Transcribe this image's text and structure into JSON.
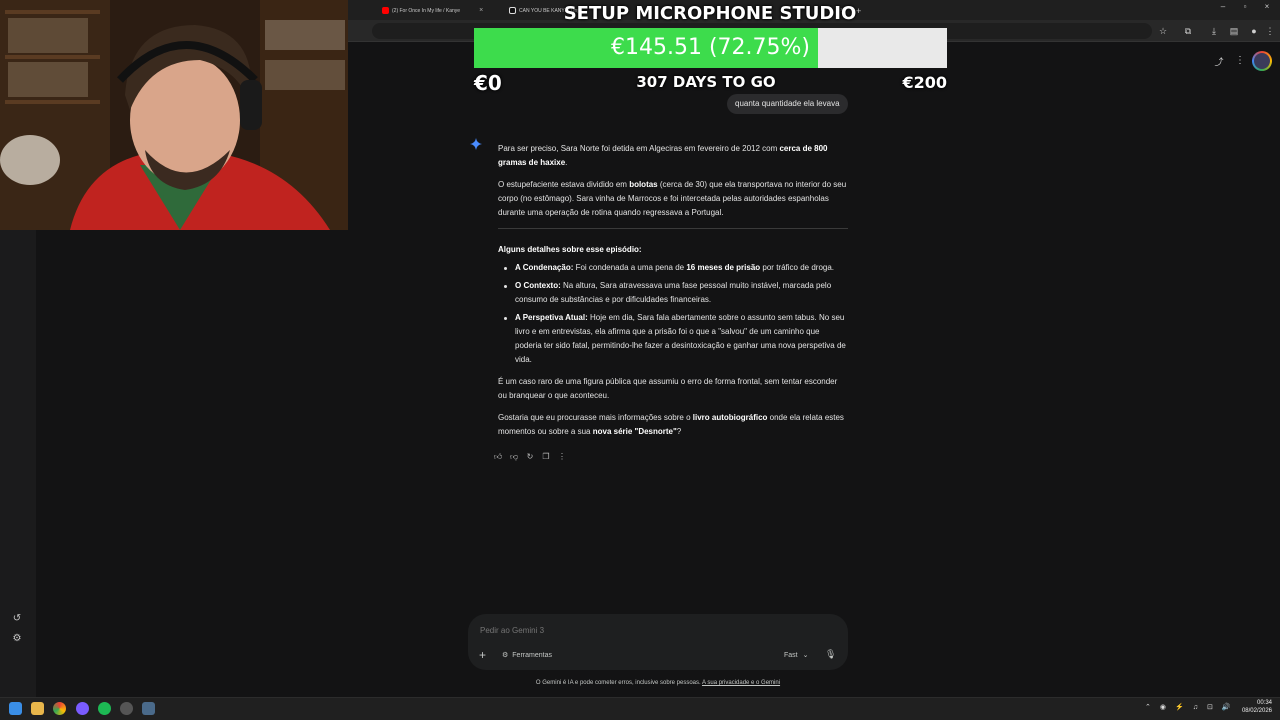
{
  "browser": {
    "tabs": [
      {
        "label": "(2) For Once In My life / Kanye",
        "icon": "youtube-icon",
        "color": "#ff0000"
      },
      {
        "label": "CAN YOU BE KANYE: Unpa",
        "icon": "tiktok-icon",
        "color": "#ffffff"
      }
    ],
    "new_tab": "+"
  },
  "overlay": {
    "title": "SETUP MICROPHONE STUDIO",
    "goal_text": "€145.51 (72.75%)",
    "goal_fraction": 0.7275,
    "goal_min": "€0",
    "goal_max": "€200",
    "days_left": "307 DAYS TO GO"
  },
  "chat": {
    "user_message": "quanta quantidade ela levava",
    "answer": {
      "p1_a": "Para ser preciso, Sara Norte foi detida em Algeciras em fevereiro de 2012 com ",
      "p1_b": "cerca de 800 gramas de haxixe",
      "p1_c": ".",
      "p2_a": "O estupefaciente estava dividido em ",
      "p2_b": "bolotas",
      "p2_c": " (cerca de 30) que ela transportava no interior do seu corpo (no estômago). Sara vinha de Marrocos e foi intercetada pelas autoridades espanholas durante uma operação de rotina quando regressava a Portugal.",
      "details_heading": "Alguns detalhes sobre esse episódio:",
      "b1_label": "A Condenação:",
      "b1_a": " Foi condenada a uma pena de ",
      "b1_b": "16 meses de prisão",
      "b1_c": " por tráfico de droga.",
      "b2_label": "O Contexto:",
      "b2_text": " Na altura, Sara atravessava uma fase pessoal muito instável, marcada pelo consumo de substâncias e por dificuldades financeiras.",
      "b3_label": "A Perspetiva Atual:",
      "b3_text": " Hoje em dia, Sara fala abertamente sobre o assunto sem tabus. No seu livro e em entrevistas, ela afirma que a prisão foi o que a \"salvou\" de um caminho que poderia ter sido fatal, permitindo-lhe fazer a desintoxicação e ganhar uma nova perspetiva de vida.",
      "p3": "É um caso raro de uma figura pública que assumiu o erro de forma frontal, sem tentar esconder ou branquear o que aconteceu.",
      "p4_a": "Gostaria que eu procurasse mais informações sobre o ",
      "p4_b": "livro autobiográfico",
      "p4_c": " onde ela relata estes momentos ou sobre a sua ",
      "p4_d": "nova série \"Desnorte\"",
      "p4_e": "?"
    }
  },
  "input": {
    "placeholder": "Pedir ao Gemini 3",
    "tools_label": "Ferramentas",
    "model_label": "Fast",
    "plus": "+"
  },
  "footer": {
    "disclaimer": "O Gemini é IA e pode cometer erros, inclusive sobre pessoas. ",
    "privacy_link": "A sua privacidade e o Gemini"
  },
  "taskbar": {
    "time": "00:34",
    "date": "08/02/2026"
  },
  "colors": {
    "accent_green": "#3ddc4c",
    "gemini_blue": "#4a8cff",
    "background": "#131314"
  }
}
